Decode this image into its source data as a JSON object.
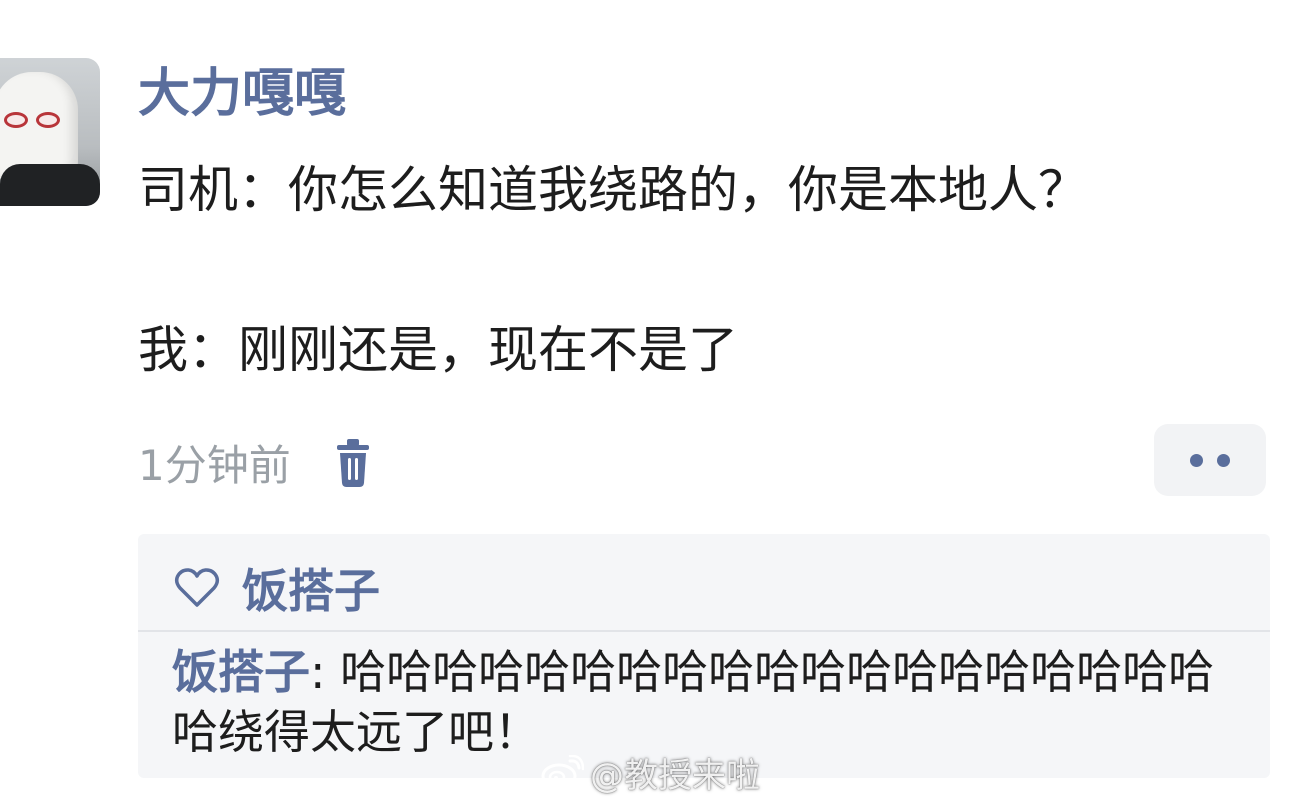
{
  "post": {
    "username": "大力嘎嘎",
    "lines": [
      "司机：你怎么知道我绕路的，你是本地人？",
      "我：刚刚还是，现在不是了"
    ],
    "timestamp": "1分钟前"
  },
  "icons": {
    "avatar": "avatar-photo",
    "delete": "trash-icon",
    "more": "more-dots-icon",
    "like": "heart-outline-icon",
    "watermark_logo": "weibo-logo-icon"
  },
  "likes": {
    "liker": "饭搭子"
  },
  "reply": {
    "author": "饭搭子",
    "separator": ": ",
    "text": "哈哈哈哈哈哈哈哈哈哈哈哈哈哈哈哈哈哈哈哈绕得太远了吧！"
  },
  "watermark": {
    "text": "@教授来啦"
  },
  "colors": {
    "name_blue": "#5a6e9c",
    "text": "#1d1d1d",
    "timestamp_gray": "#9aa0a6",
    "panel_bg": "#f5f6f8"
  }
}
